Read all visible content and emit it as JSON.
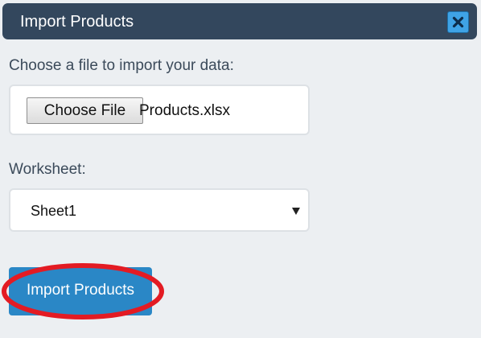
{
  "dialog": {
    "title": "Import Products",
    "close_icon": "close-icon"
  },
  "file": {
    "label": "Choose a file to import your data:",
    "button_label": "Choose File",
    "selected_file": "Products.xlsx"
  },
  "worksheet": {
    "label": "Worksheet:",
    "selected": "Sheet1",
    "caret_icon": "caret-down-icon"
  },
  "actions": {
    "import_label": "Import Products"
  },
  "colors": {
    "titlebar": "#33475d",
    "close_button": "#3fa3e6",
    "primary_button": "#2a87c6",
    "highlight_ring": "#e31b23"
  }
}
